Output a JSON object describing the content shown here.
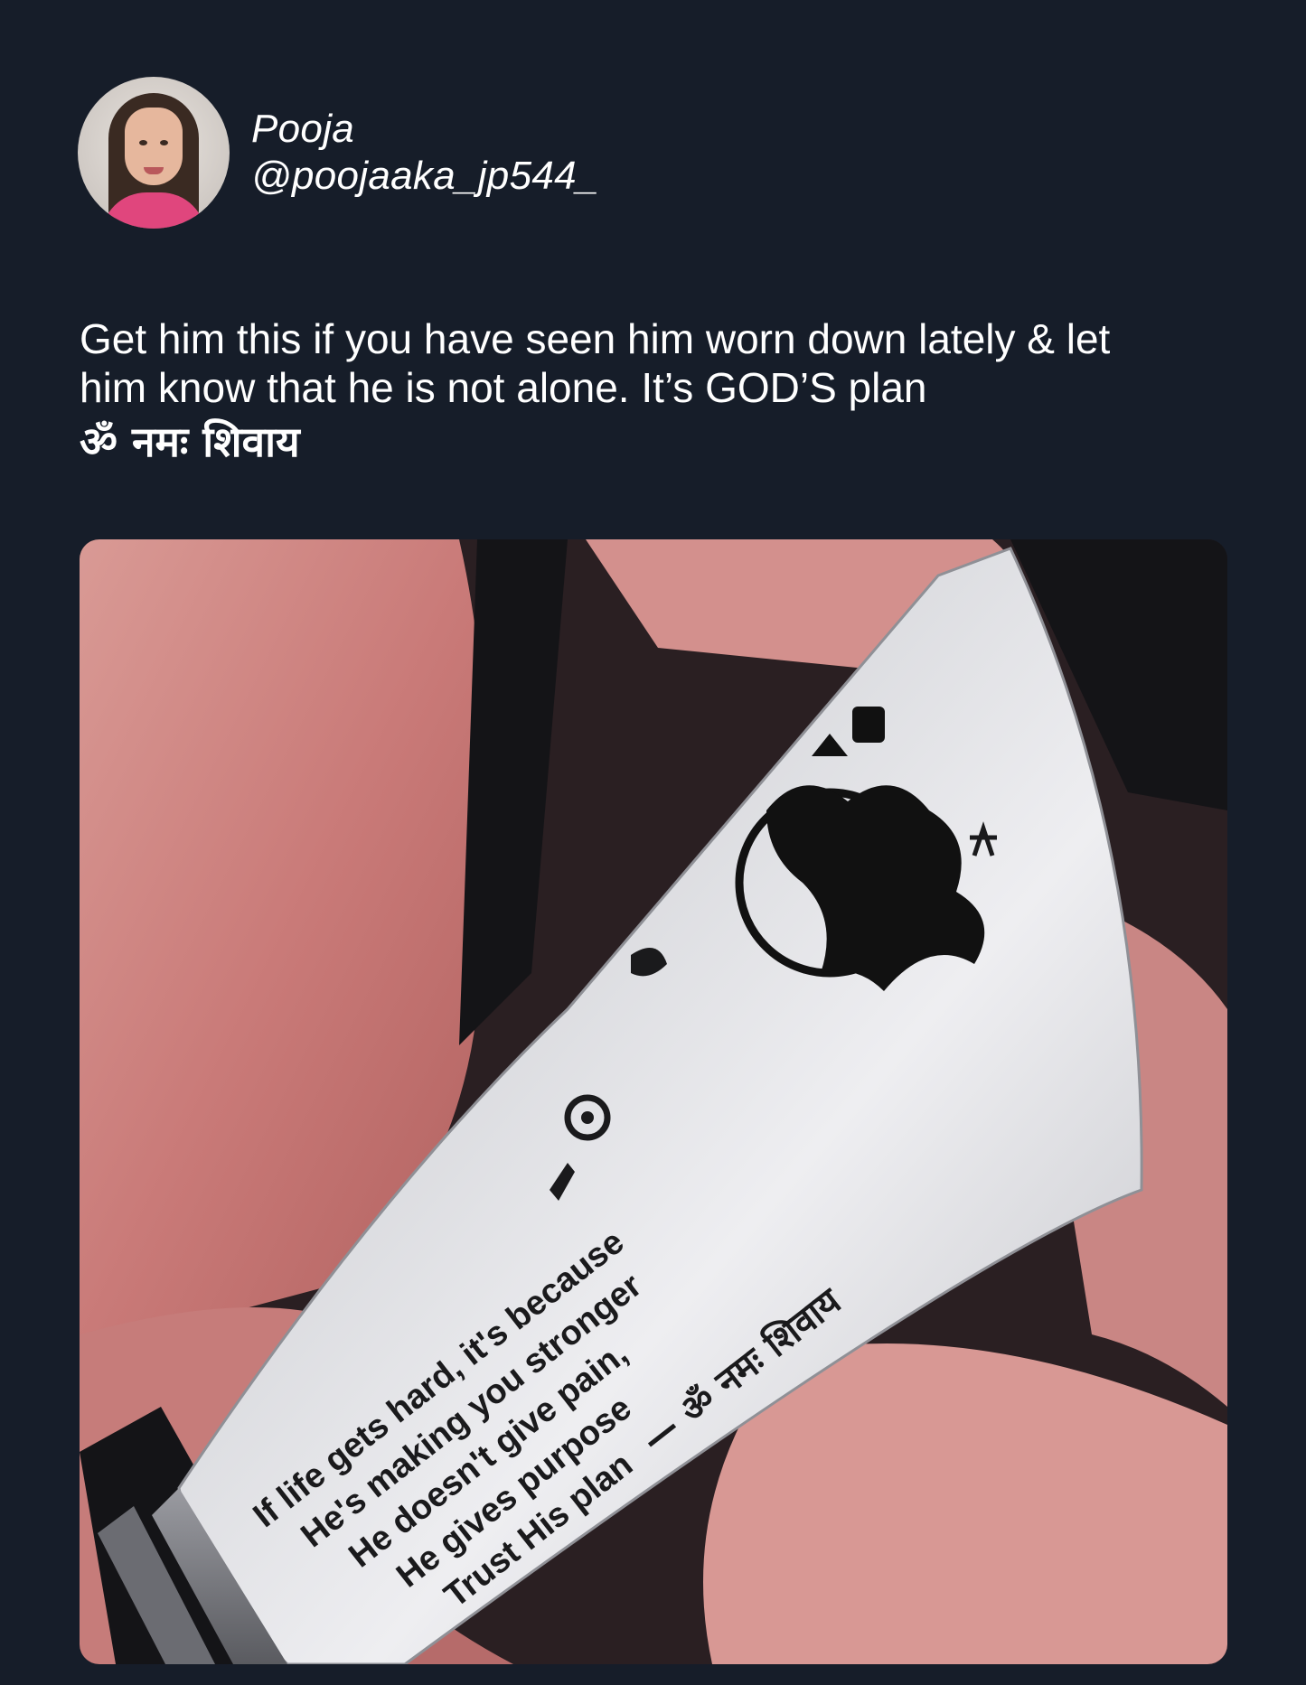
{
  "author": {
    "display_name": "Pooja",
    "handle": "@poojaaka_jp544_"
  },
  "tweet": {
    "line1": "Get him this if you have seen him worn down lately & let",
    "line2": "him know that he is not alone. It’s GOD’S plan",
    "line3": "ॐ नमः शिवाय"
  },
  "media": {
    "bracelet_lines": [
      "If life gets hard, it's because",
      "He's making you stronger",
      "He doesn't give pain,",
      "He gives purpose",
      "Trust His plan"
    ],
    "bracelet_mantra": "— ॐ नमः शिवाय"
  }
}
